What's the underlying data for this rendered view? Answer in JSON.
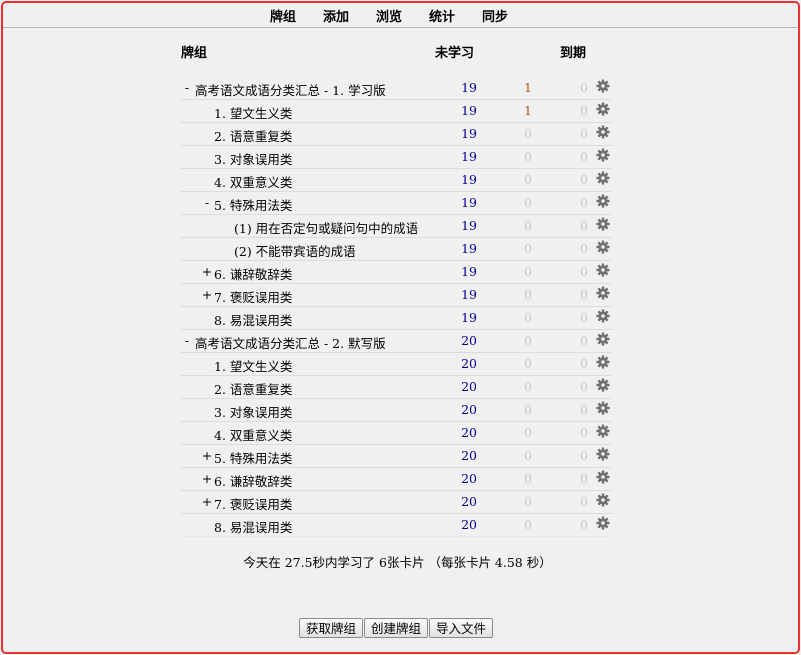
{
  "toolbar": {
    "decks": "牌组",
    "add": "添加",
    "browse": "浏览",
    "stats": "统计",
    "sync": "同步"
  },
  "table_headers": {
    "deck": "牌组",
    "new": "未学习",
    "due": "到期"
  },
  "colors": {
    "new": "#000090",
    "learn": "#c0521f",
    "zero": "#c8c8c8",
    "frame": "#e8322f"
  },
  "decks": [
    {
      "toggle": "-",
      "name": "高考语文成语分类汇总 - 1. 学习版",
      "level": 0,
      "new": "19",
      "learn": "1",
      "due": "0"
    },
    {
      "toggle": "",
      "name": "1. 望文生义类",
      "level": 1,
      "new": "19",
      "learn": "1",
      "due": "0"
    },
    {
      "toggle": "",
      "name": "2. 语意重复类",
      "level": 1,
      "new": "19",
      "learn": "0",
      "due": "0"
    },
    {
      "toggle": "",
      "name": "3. 对象误用类",
      "level": 1,
      "new": "19",
      "learn": "0",
      "due": "0"
    },
    {
      "toggle": "",
      "name": "4. 双重意义类",
      "level": 1,
      "new": "19",
      "learn": "0",
      "due": "0"
    },
    {
      "toggle": "-",
      "name": "5. 特殊用法类",
      "level": 1,
      "new": "19",
      "learn": "0",
      "due": "0"
    },
    {
      "toggle": "",
      "name": "(1) 用在否定句或疑问句中的成语",
      "level": 2,
      "new": "19",
      "learn": "0",
      "due": "0"
    },
    {
      "toggle": "",
      "name": "(2) 不能带宾语的成语",
      "level": 2,
      "new": "19",
      "learn": "0",
      "due": "0"
    },
    {
      "toggle": "+",
      "name": "6. 谦辞敬辞类",
      "level": 1,
      "new": "19",
      "learn": "0",
      "due": "0"
    },
    {
      "toggle": "+",
      "name": "7. 褒贬误用类",
      "level": 1,
      "new": "19",
      "learn": "0",
      "due": "0"
    },
    {
      "toggle": "",
      "name": "8. 易混误用类",
      "level": 1,
      "new": "19",
      "learn": "0",
      "due": "0"
    },
    {
      "toggle": "-",
      "name": "高考语文成语分类汇总 - 2. 默写版",
      "level": 0,
      "new": "20",
      "learn": "0",
      "due": "0"
    },
    {
      "toggle": "",
      "name": "1. 望文生义类",
      "level": 1,
      "new": "20",
      "learn": "0",
      "due": "0"
    },
    {
      "toggle": "",
      "name": "2. 语意重复类",
      "level": 1,
      "new": "20",
      "learn": "0",
      "due": "0"
    },
    {
      "toggle": "",
      "name": "3. 对象误用类",
      "level": 1,
      "new": "20",
      "learn": "0",
      "due": "0"
    },
    {
      "toggle": "",
      "name": "4. 双重意义类",
      "level": 1,
      "new": "20",
      "learn": "0",
      "due": "0"
    },
    {
      "toggle": "+",
      "name": "5. 特殊用法类",
      "level": 1,
      "new": "20",
      "learn": "0",
      "due": "0"
    },
    {
      "toggle": "+",
      "name": "6. 谦辞敬辞类",
      "level": 1,
      "new": "20",
      "learn": "0",
      "due": "0"
    },
    {
      "toggle": "+",
      "name": "7. 褒贬误用类",
      "level": 1,
      "new": "20",
      "learn": "0",
      "due": "0"
    },
    {
      "toggle": "",
      "name": "8. 易混误用类",
      "level": 1,
      "new": "20",
      "learn": "0",
      "due": "0"
    }
  ],
  "stats_line": "今天在 27.5秒内学习了 6张卡片 （每张卡片 4.58 秒）",
  "buttons": {
    "get_shared": "获取牌组",
    "create_deck": "创建牌组",
    "import_file": "导入文件"
  }
}
